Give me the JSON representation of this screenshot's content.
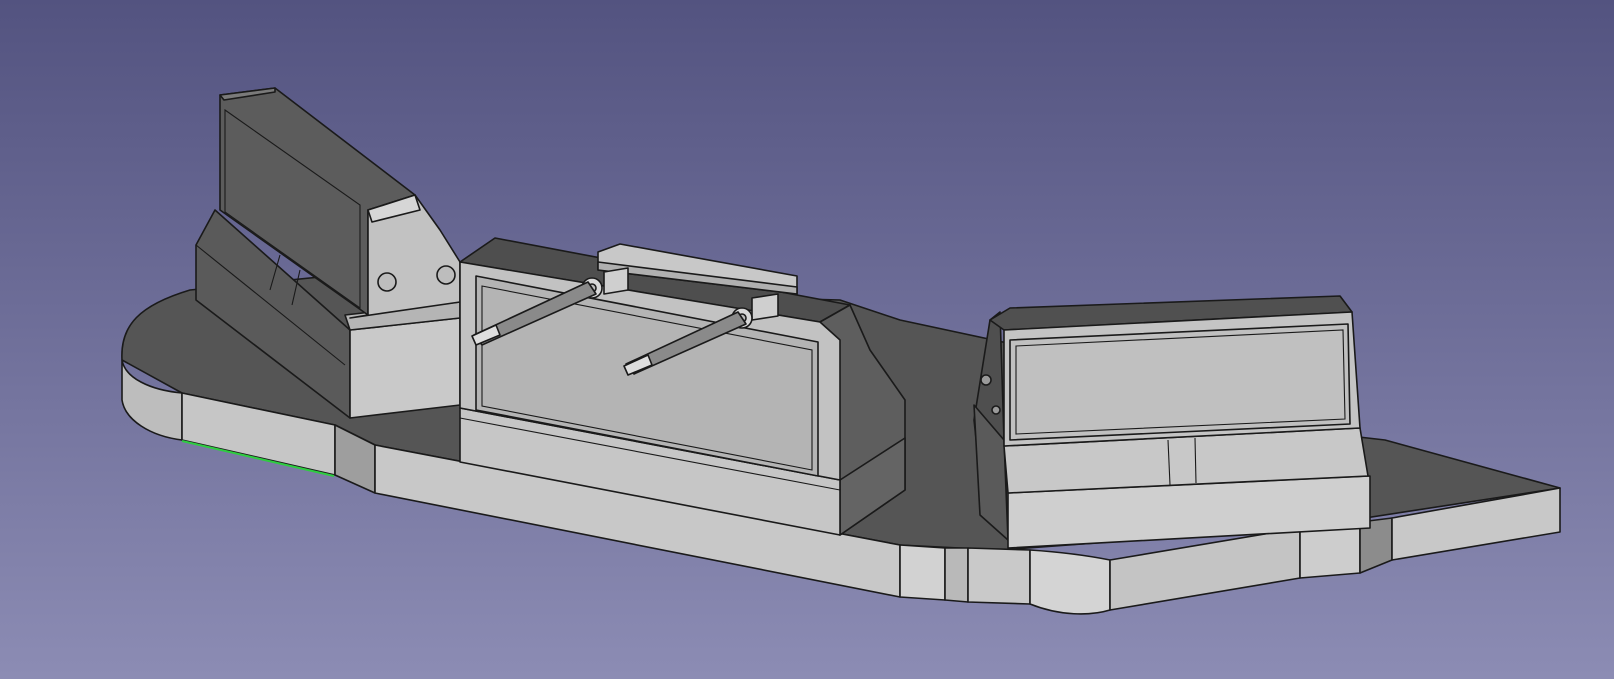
{
  "viewport": {
    "background_top": "#535380",
    "background_bottom": "#8c8cb4"
  },
  "model": {
    "face_light": "#c4c4c4",
    "face_mid": "#a8a8a8",
    "face_dark": "#5e5e5e",
    "face_top": "#555555",
    "edge_color": "#1a1a1a",
    "selected_edge_color": "#2ecc40"
  }
}
